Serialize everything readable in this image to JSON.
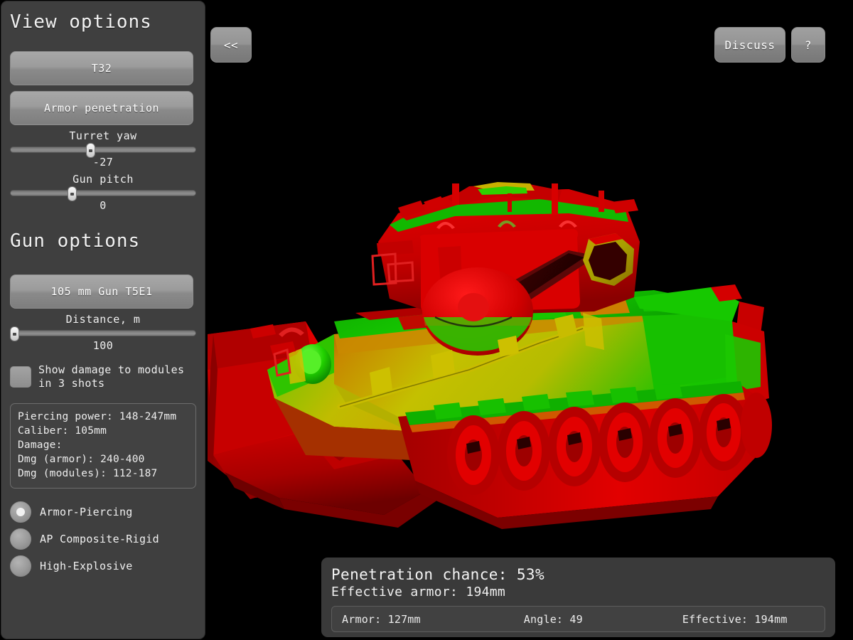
{
  "sidebar": {
    "view_options": {
      "title": "View options",
      "tank_button": "T32",
      "mode_button": "Armor penetration",
      "turret_yaw": {
        "label": "Turret yaw",
        "value": "-27",
        "percent": 43
      },
      "gun_pitch": {
        "label": "Gun pitch",
        "value": "0",
        "percent": 33
      }
    },
    "gun_options": {
      "title": "Gun options",
      "gun_button": "105 mm Gun T5E1",
      "distance": {
        "label": "Distance, m",
        "value": "100",
        "percent": 2
      },
      "show_damage_checkbox": {
        "label": "Show damage to modules in 3 shots",
        "checked": false
      },
      "info": {
        "piercing_power": "Piercing power: 148-247mm",
        "caliber": "Caliber: 105mm",
        "damage": "Damage:",
        "dmg_armor": "Dmg (armor): 240-400",
        "dmg_modules": "Dmg (modules): 112-187"
      },
      "shells": [
        {
          "label": "Armor-Piercing",
          "selected": true
        },
        {
          "label": "AP Composite-Rigid",
          "selected": false
        },
        {
          "label": "High-Explosive",
          "selected": false
        }
      ]
    }
  },
  "toolbar": {
    "back_button": "<<",
    "discuss_button": "Discuss",
    "help_button": "?"
  },
  "result_panel": {
    "penetration_chance": "Penetration chance: 53%",
    "effective_armor": "Effective armor: 194mm",
    "armor": "Armor: 127mm",
    "angle": "Angle: 49",
    "effective": "Effective: 194mm"
  },
  "viewport": {
    "background_color": "#000000",
    "legend_colors": {
      "impenetrable": "#e00000",
      "marginal": "#c8c000",
      "penetrable": "#18c800"
    }
  }
}
